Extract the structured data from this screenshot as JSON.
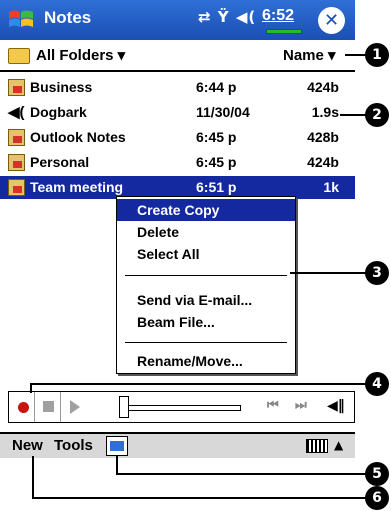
{
  "titlebar": {
    "app_title": "Notes",
    "status_icons": "⇄ Ÿ ◀(",
    "clock": "6:52",
    "close_symbol": "✕"
  },
  "folderbar": {
    "folder_label": "All Folders ▾",
    "sort_label": "Name ▾"
  },
  "files": [
    {
      "name": "Business",
      "date": "6:44 p",
      "size": "424b",
      "icon": "note-icon"
    },
    {
      "name": "Dogbark",
      "date": "11/30/04",
      "size": "1.9s",
      "icon": "sound-icon"
    },
    {
      "name": "Outlook Notes",
      "date": "6:45 p",
      "size": "428b",
      "icon": "note-icon"
    },
    {
      "name": "Personal",
      "date": "6:45 p",
      "size": "424b",
      "icon": "note-icon"
    },
    {
      "name": "Team meeting",
      "date": "6:51 p",
      "size": "1k",
      "icon": "note-icon",
      "selected": true
    }
  ],
  "context_menu": {
    "items": [
      "Create Copy",
      "Delete",
      "Select All",
      "Send via E-mail...",
      "Beam File...",
      "Rename/Move..."
    ]
  },
  "recorder": {
    "record_icon": "record-icon",
    "stop_icon": "stop-icon",
    "play_icon": "play-icon",
    "prev_icon": "skip-back-icon",
    "next_icon": "skip-forward-icon",
    "volume_icon": "volume-icon",
    "prev_symbol": "⏮",
    "next_symbol": "⏭",
    "volume_symbol": "◀‖"
  },
  "cmdbar": {
    "new_label": "New",
    "tools_label": "Tools",
    "sip_arrow": "▲"
  },
  "callouts": [
    "1",
    "2",
    "3",
    "4",
    "5",
    "6"
  ],
  "colors": {
    "titlebar": "#1b4fb3",
    "selection": "#1428a0",
    "record": "#c8140e"
  }
}
